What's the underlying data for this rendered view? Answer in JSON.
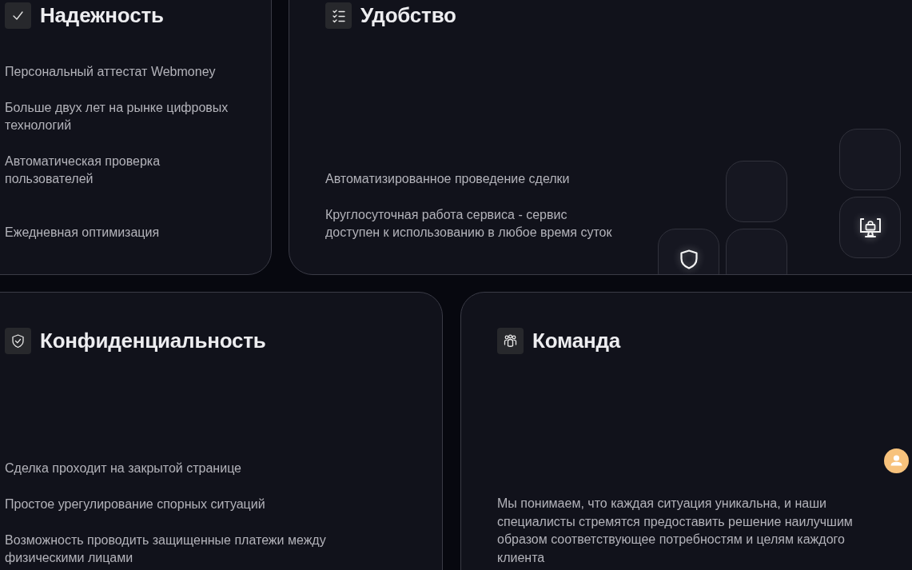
{
  "cards": [
    {
      "kind": "list",
      "title": "Надежность",
      "items": [
        "Персональный аттестат Webmoney",
        "Больше двух лет на рынке цифровых технологий",
        "Автоматическая проверка пользователей",
        "Ежедневная оптимизация"
      ]
    },
    {
      "kind": "list",
      "title": "Удобство",
      "items": [
        "Автоматизированное проведение сделки",
        "Круглосуточная работа сервиса - сервис доступен к использованию в любое время суток"
      ]
    },
    {
      "kind": "list",
      "title": "Конфиденциальность",
      "items": [
        "Сделка проходит на закрытой странице",
        "Простое урегулирование спорных ситуаций",
        "Возможность проводить защищенные платежи между физическими лицами"
      ]
    },
    {
      "kind": "paragraph",
      "title": "Команда",
      "text": "Мы понимаем, что каждая ситуация уникальна, и наши специалисты стремятся предоставить решение наилучшим образом соответствующее потребностям и целям каждого клиента"
    }
  ]
}
